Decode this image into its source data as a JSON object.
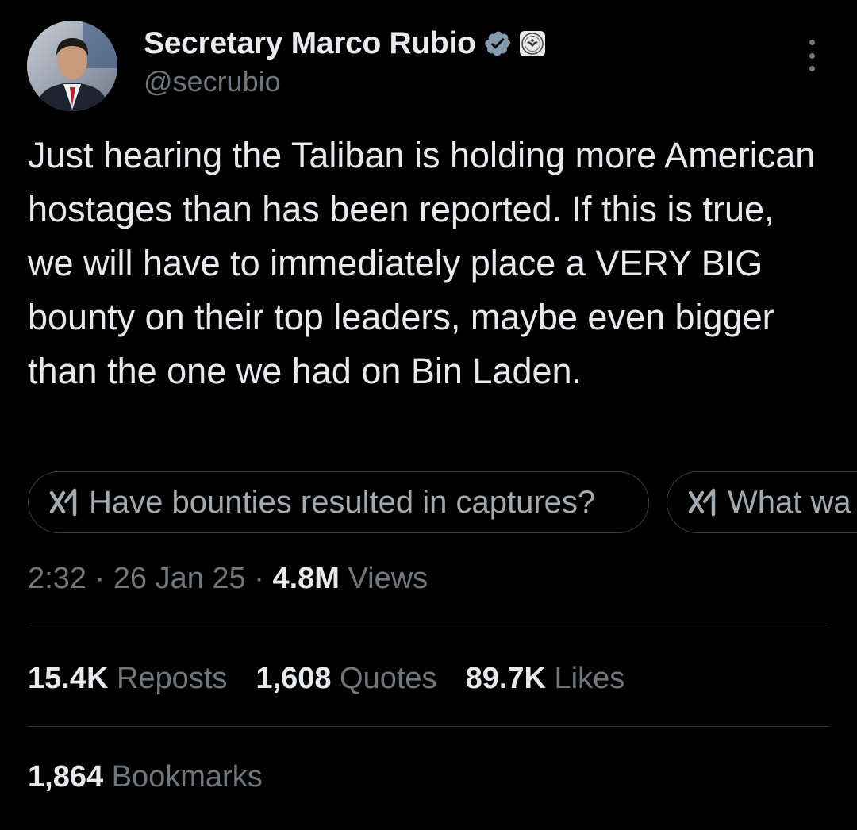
{
  "author": {
    "display_name": "Secretary Marco Rubio",
    "handle": "@secrubio",
    "avatar_icon": "profile-photo",
    "verified_icon": "verified-badge-icon",
    "affiliation_icon": "state-department-seal-icon"
  },
  "tweet": {
    "text": "Just hearing the Taliban is holding more American hostages than has been reported. If this is true, we will have to immediately place a VERY BIG bounty on their top leaders, maybe even bigger than the one we had on Bin Laden."
  },
  "grok_prompts": [
    {
      "label": "Have bounties resulted in captures?",
      "icon": "grok-icon"
    },
    {
      "label": "What wa",
      "icon": "grok-icon"
    }
  ],
  "meta": {
    "time": "2:32",
    "date": "26 Jan 25",
    "separator": " · ",
    "views_count": "4.8M",
    "views_label": "Views"
  },
  "stats": {
    "reposts_count": "15.4K",
    "reposts_label": "Reposts",
    "quotes_count": "1,608",
    "quotes_label": "Quotes",
    "likes_count": "89.7K",
    "likes_label": "Likes",
    "bookmarks_count": "1,864",
    "bookmarks_label": "Bookmarks"
  },
  "colors": {
    "background": "#000000",
    "primary_text": "#e7e9ea",
    "secondary_text": "#71767b",
    "verified": "#829aab",
    "divider": "#2f3336"
  }
}
